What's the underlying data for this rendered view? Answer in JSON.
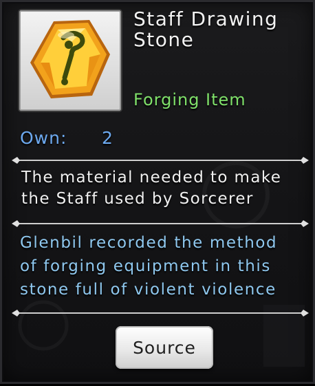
{
  "item": {
    "title": "Staff Drawing Stone",
    "title_line1": "Staff Drawing",
    "title_line2": "Stone",
    "icon": "golden-hexagon-staff-stone-icon",
    "category": "Forging Item"
  },
  "ownership": {
    "label": "Own:",
    "count": "2"
  },
  "description": {
    "line1": "The material needed to make",
    "line2": "the Staff used by Sorcerer"
  },
  "lore": {
    "line1": "Glenbil recorded the method",
    "line2": "of forging equipment in this",
    "line3": "stone full of violent violence"
  },
  "actions": {
    "source_label": "Source"
  },
  "colors": {
    "title": "#f2f2f2",
    "category": "#7fe06a",
    "own": "#6da9ef",
    "lore": "#8fc8ef",
    "gem": "#f2a21c"
  }
}
